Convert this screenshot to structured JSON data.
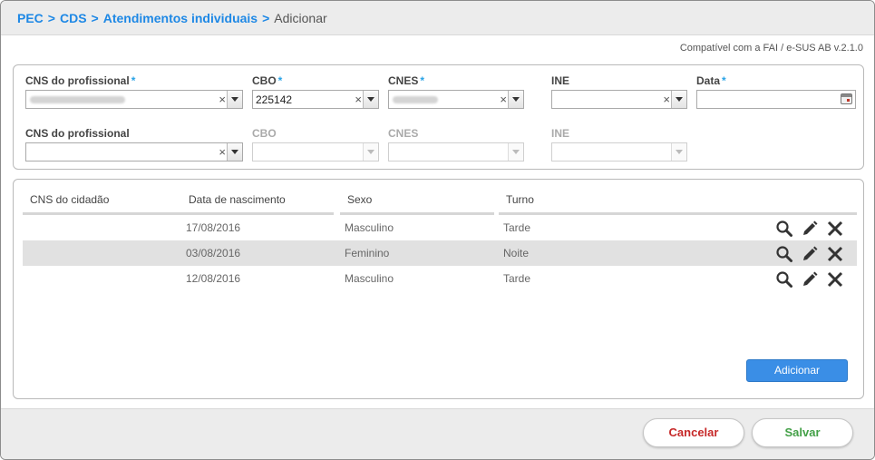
{
  "breadcrumb": {
    "items": [
      "PEC",
      "CDS",
      "Atendimentos individuais"
    ],
    "separator": ">",
    "current": "Adicionar"
  },
  "compat_text": "Compatível com a FAI / e-SUS AB v.2.1.0",
  "required_mark": "*",
  "form": {
    "row1": {
      "cns_label": "CNS do profissional",
      "cbo_label": "CBO",
      "cbo_value": "225142",
      "cnes_label": "CNES",
      "ine_label": "INE",
      "data_label": "Data"
    },
    "row2": {
      "cns_label": "CNS do profissional",
      "cbo_label": "CBO",
      "cnes_label": "CNES",
      "ine_label": "INE"
    },
    "clear_glyph": "×"
  },
  "table": {
    "columns": [
      "CNS do cidadão",
      "Data de nascimento",
      "Sexo",
      "Turno"
    ],
    "rows": [
      {
        "cns": "",
        "nascimento": "17/08/2016",
        "sexo": "Masculino",
        "turno": "Tarde"
      },
      {
        "cns": "",
        "nascimento": "03/08/2016",
        "sexo": "Feminino",
        "turno": "Noite"
      },
      {
        "cns": "",
        "nascimento": "12/08/2016",
        "sexo": "Masculino",
        "turno": "Tarde"
      }
    ],
    "row_actions": [
      "search-icon",
      "pencil-icon",
      "close-icon"
    ]
  },
  "buttons": {
    "add": "Adicionar",
    "cancel": "Cancelar",
    "save": "Salvar"
  },
  "colors": {
    "link": "#1e88e5",
    "required": "#29a3e6",
    "primary_button": "#3a8ee6",
    "cancel_text": "#c62828",
    "save_text": "#43a047"
  }
}
